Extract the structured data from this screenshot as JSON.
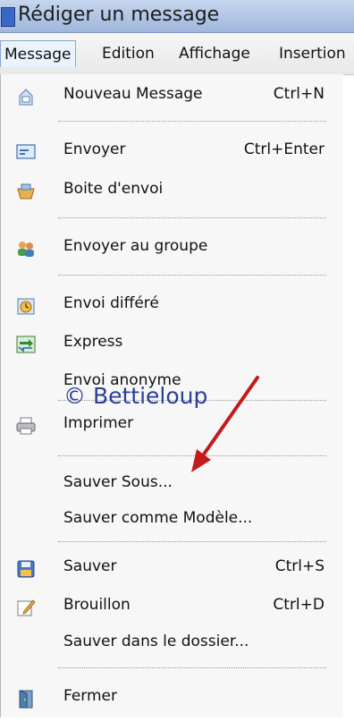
{
  "window": {
    "title": "Rédiger un message"
  },
  "menubar": {
    "items": [
      {
        "label": "Message",
        "active": true
      },
      {
        "label": "Edition"
      },
      {
        "label": "Affichage"
      },
      {
        "label": "Insertion"
      }
    ]
  },
  "menu": {
    "items": {
      "nouveau_message": {
        "label": "Nouveau Message",
        "shortcut": "Ctrl+N",
        "icon": "new-message-icon"
      },
      "envoyer": {
        "label": "Envoyer",
        "shortcut": "Ctrl+Enter",
        "icon": "send-icon"
      },
      "boite_envoi": {
        "label": "Boite d'envoi",
        "icon": "outbox-icon"
      },
      "envoyer_groupe": {
        "label": "Envoyer au groupe",
        "icon": "group-icon"
      },
      "envoi_differe": {
        "label": "Envoi différé",
        "icon": "clock-icon"
      },
      "express": {
        "label": "Express",
        "icon": "express-icon"
      },
      "envoi_anonyme": {
        "label": "Envoi anonyme"
      },
      "imprimer": {
        "label": "Imprimer",
        "icon": "printer-icon"
      },
      "sauver_sous": {
        "label": "Sauver Sous..."
      },
      "sauver_modele": {
        "label": "Sauver comme Modèle..."
      },
      "sauver": {
        "label": "Sauver",
        "shortcut": "Ctrl+S",
        "icon": "save-icon"
      },
      "brouillon": {
        "label": "Brouillon",
        "shortcut": "Ctrl+D",
        "icon": "draft-icon"
      },
      "sauver_dossier": {
        "label": "Sauver dans le dossier..."
      },
      "fermer": {
        "label": "Fermer",
        "icon": "door-icon"
      }
    }
  },
  "watermark": "© Bettieloup",
  "colors": {
    "arrow": "#c41a1a",
    "watermark": "#2a3f96",
    "titlebar": "#aebfe0"
  }
}
